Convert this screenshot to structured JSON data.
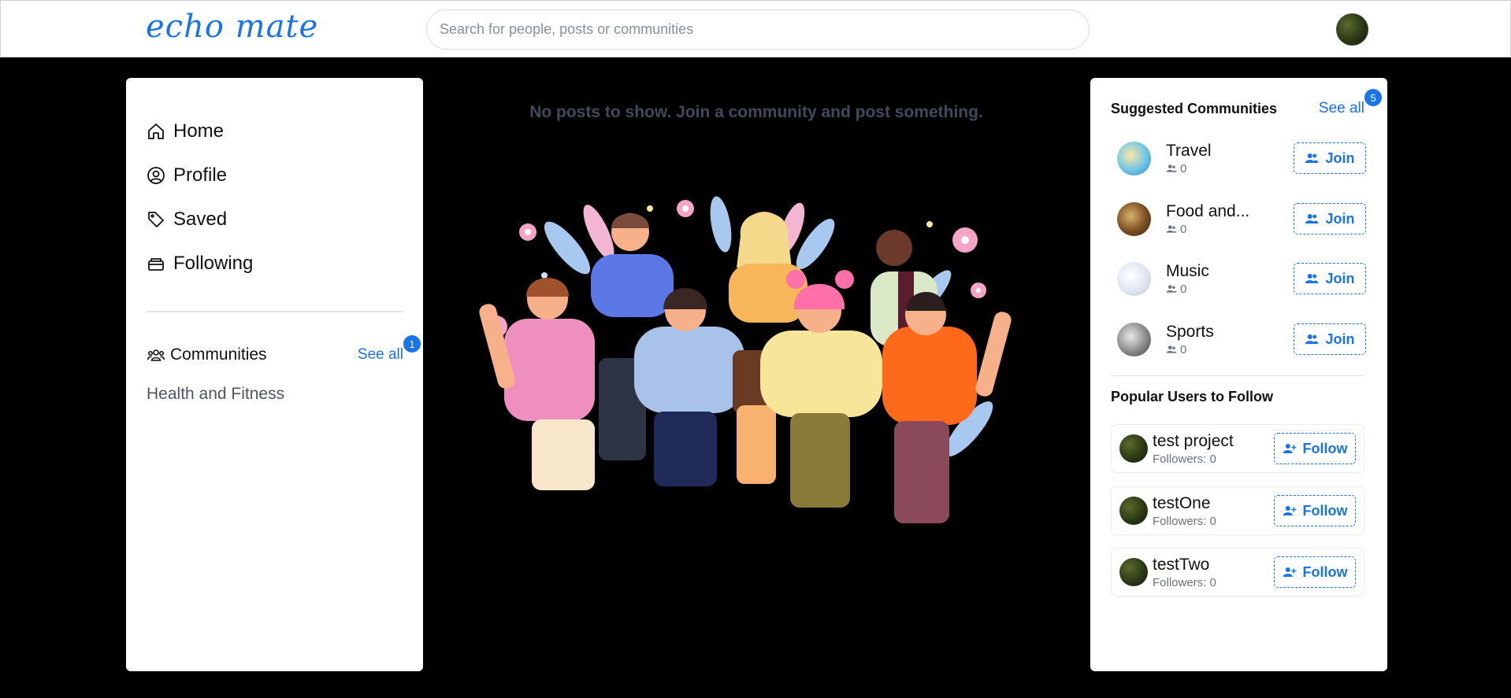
{
  "app": {
    "logo": "echo mate"
  },
  "search": {
    "placeholder": "Search for people, posts or communities"
  },
  "nav": {
    "items": [
      {
        "label": "Home",
        "icon": "home-icon"
      },
      {
        "label": "Profile",
        "icon": "user-circle-icon"
      },
      {
        "label": "Saved",
        "icon": "tag-icon"
      },
      {
        "label": "Following",
        "icon": "inbox-icon"
      }
    ]
  },
  "communities": {
    "title": "Communities",
    "see_all": "See all",
    "badge": "1",
    "items": [
      "Health and Fitness"
    ]
  },
  "feed": {
    "empty_message": "No posts to show. Join a community and post something."
  },
  "suggested": {
    "title": "Suggested Communities",
    "see_all": "See all",
    "badge": "5",
    "join_label": "Join",
    "items": [
      {
        "name": "Travel",
        "members": "0"
      },
      {
        "name": "Food and...",
        "members": "0"
      },
      {
        "name": "Music",
        "members": "0"
      },
      {
        "name": "Sports",
        "members": "0"
      }
    ]
  },
  "popular": {
    "title": "Popular Users to Follow",
    "follow_label": "Follow",
    "users": [
      {
        "name": "test project",
        "followers": "Followers: 0"
      },
      {
        "name": "testOne",
        "followers": "Followers: 0"
      },
      {
        "name": "testTwo",
        "followers": "Followers: 0"
      }
    ]
  },
  "colors": {
    "accent": "#1a73e8",
    "background": "#000000"
  }
}
